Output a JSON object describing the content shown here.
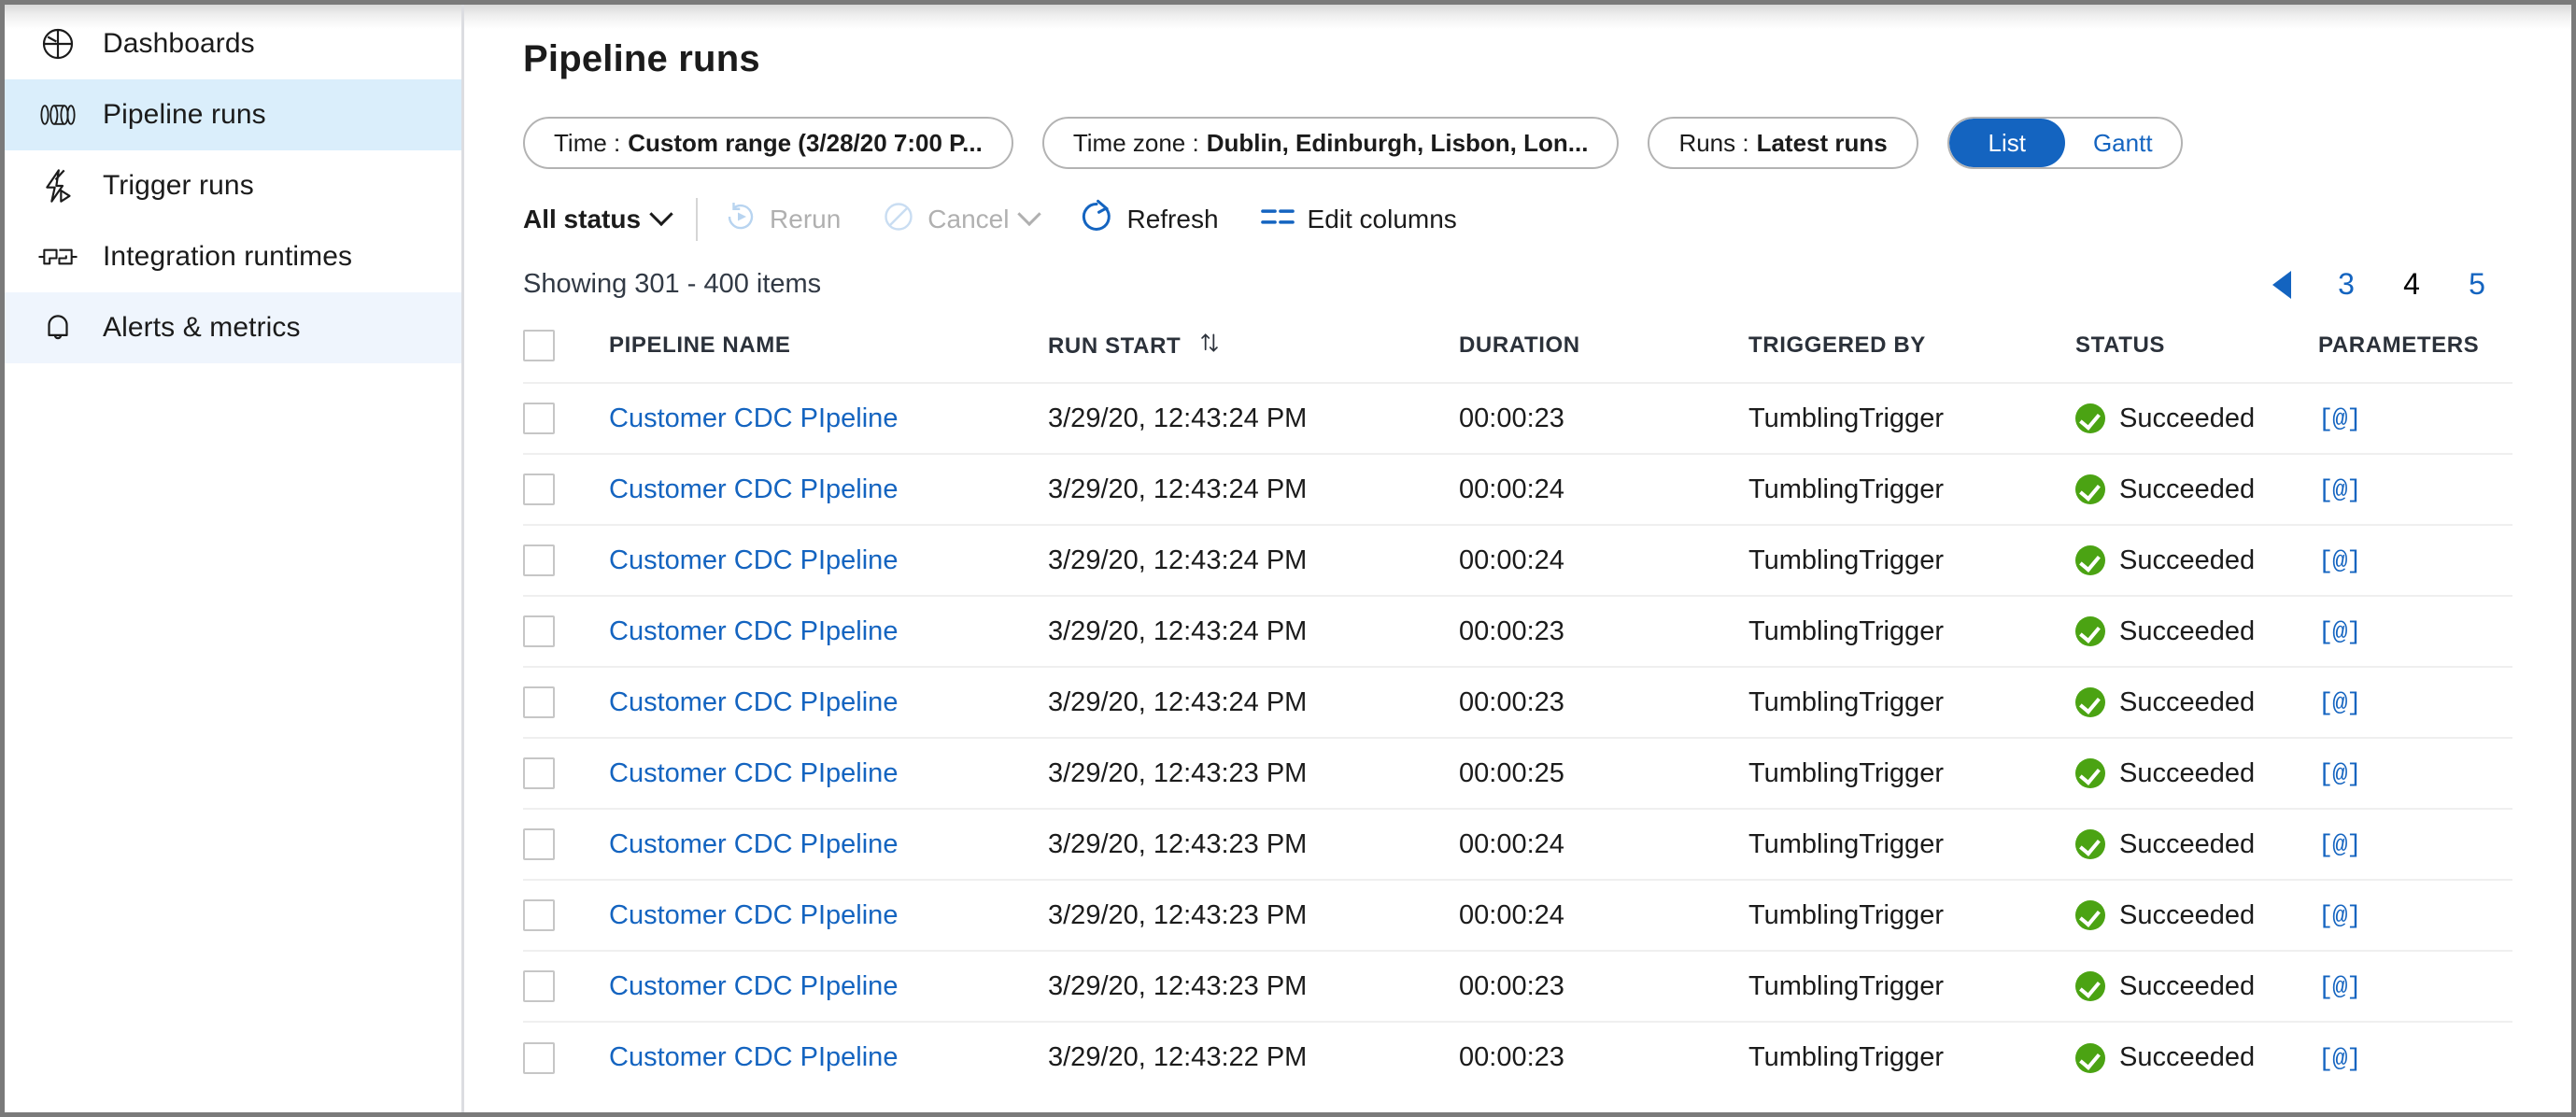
{
  "sidebar": {
    "items": [
      {
        "label": "Dashboards",
        "icon": "pie-chart-icon",
        "state": "normal"
      },
      {
        "label": "Pipeline runs",
        "icon": "pipeline-icon",
        "state": "selected"
      },
      {
        "label": "Trigger runs",
        "icon": "lightning-play-icon",
        "state": "normal"
      },
      {
        "label": "Integration runtimes",
        "icon": "integration-runtime-icon",
        "state": "normal"
      },
      {
        "label": "Alerts & metrics",
        "icon": "bell-icon",
        "state": "alt-selected"
      }
    ]
  },
  "header": {
    "title": "Pipeline runs"
  },
  "filters": {
    "time": {
      "key": "Time :",
      "value": "Custom range (3/28/20 7:00 P..."
    },
    "time_zone": {
      "key": "Time zone :",
      "value": "Dublin, Edinburgh, Lisbon, Lon..."
    },
    "runs": {
      "key": "Runs :",
      "value": "Latest runs"
    },
    "view_toggle": {
      "options": [
        "List",
        "Gantt"
      ],
      "selected": "List"
    }
  },
  "toolbar": {
    "status_filter": "All status",
    "rerun": "Rerun",
    "cancel": "Cancel",
    "refresh": "Refresh",
    "edit_columns": "Edit columns"
  },
  "paging": {
    "showing": "Showing 301 - 400 items",
    "prev_arrow": "prev-page-arrow",
    "pages": [
      "3",
      "4",
      "5"
    ],
    "current_page": "4"
  },
  "colors": {
    "accent": "#1464c0",
    "link": "#1464c0",
    "success": "#4ba313",
    "selected_nav": "#daeefb",
    "alt_selected_nav": "#eff5fd",
    "border": "#7a7a7a"
  },
  "table": {
    "columns": [
      {
        "key": "checkbox",
        "label": ""
      },
      {
        "key": "name",
        "label": "PIPELINE NAME"
      },
      {
        "key": "run_start",
        "label": "RUN START",
        "sortable": true
      },
      {
        "key": "duration",
        "label": "DURATION"
      },
      {
        "key": "triggered",
        "label": "TRIGGERED BY"
      },
      {
        "key": "status",
        "label": "STATUS"
      },
      {
        "key": "parameters",
        "label": "PARAMETERS"
      }
    ],
    "parameter_glyph": "[@]",
    "rows": [
      {
        "name": "Customer CDC PIpeline",
        "run_start": "3/29/20, 12:43:24 PM",
        "duration": "00:00:23",
        "triggered": "TumblingTrigger",
        "status": "Succeeded"
      },
      {
        "name": "Customer CDC PIpeline",
        "run_start": "3/29/20, 12:43:24 PM",
        "duration": "00:00:24",
        "triggered": "TumblingTrigger",
        "status": "Succeeded"
      },
      {
        "name": "Customer CDC PIpeline",
        "run_start": "3/29/20, 12:43:24 PM",
        "duration": "00:00:24",
        "triggered": "TumblingTrigger",
        "status": "Succeeded"
      },
      {
        "name": "Customer CDC PIpeline",
        "run_start": "3/29/20, 12:43:24 PM",
        "duration": "00:00:23",
        "triggered": "TumblingTrigger",
        "status": "Succeeded"
      },
      {
        "name": "Customer CDC PIpeline",
        "run_start": "3/29/20, 12:43:24 PM",
        "duration": "00:00:23",
        "triggered": "TumblingTrigger",
        "status": "Succeeded"
      },
      {
        "name": "Customer CDC PIpeline",
        "run_start": "3/29/20, 12:43:23 PM",
        "duration": "00:00:25",
        "triggered": "TumblingTrigger",
        "status": "Succeeded"
      },
      {
        "name": "Customer CDC PIpeline",
        "run_start": "3/29/20, 12:43:23 PM",
        "duration": "00:00:24",
        "triggered": "TumblingTrigger",
        "status": "Succeeded"
      },
      {
        "name": "Customer CDC PIpeline",
        "run_start": "3/29/20, 12:43:23 PM",
        "duration": "00:00:24",
        "triggered": "TumblingTrigger",
        "status": "Succeeded"
      },
      {
        "name": "Customer CDC PIpeline",
        "run_start": "3/29/20, 12:43:23 PM",
        "duration": "00:00:23",
        "triggered": "TumblingTrigger",
        "status": "Succeeded"
      },
      {
        "name": "Customer CDC PIpeline",
        "run_start": "3/29/20, 12:43:22 PM",
        "duration": "00:00:23",
        "triggered": "TumblingTrigger",
        "status": "Succeeded"
      }
    ]
  }
}
